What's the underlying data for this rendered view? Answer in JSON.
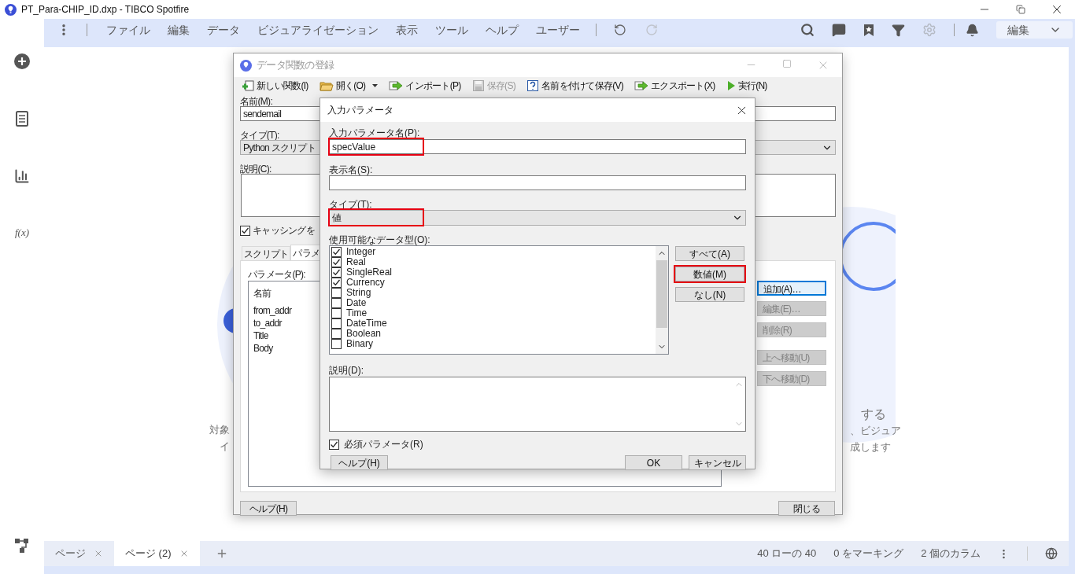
{
  "app": {
    "title": "PT_Para-CHIP_ID.dxp - TIBCO Spotfire"
  },
  "sidebar": {
    "function_label": "f(x)"
  },
  "menu": [
    "ファイル",
    "編集",
    "データ",
    "ビジュアライゼーション",
    "表示",
    "ツール",
    "ヘルプ",
    "ユーザー"
  ],
  "toolbar": {
    "redo_disabled": true,
    "settings_disabled": true,
    "mode": "編集"
  },
  "canvas_hint": {
    "left_lines": [
      "対象",
      "イ"
    ],
    "right_lines": [
      "する",
      "、ビジュア",
      "成します"
    ]
  },
  "function_dialog": {
    "title": "データ関数の登録",
    "toolbar": [
      {
        "kind": "new",
        "label": "新しい関数(I)",
        "disabled": false
      },
      {
        "kind": "open",
        "label": "開く(O)",
        "disabled": false
      },
      {
        "kind": "import",
        "label": "インポート(P)",
        "disabled": false
      },
      {
        "kind": "save",
        "label": "保存(S)",
        "disabled": true
      },
      {
        "kind": "save_as",
        "label": "名前を付けて保存(V)",
        "disabled": false
      },
      {
        "kind": "export",
        "label": "エクスポート(X)",
        "disabled": false
      },
      {
        "kind": "run",
        "label": "実行(N)",
        "disabled": false
      }
    ],
    "name_label": "名前(M):",
    "name_value": "sendemail",
    "type_label": "タイプ(T):",
    "type_value": "Python スクリプト",
    "desc_label": "説明(C):",
    "caching": {
      "label": "キャッシングを",
      "checked": true
    },
    "tabs": [
      {
        "label": "スクリプト",
        "selected": false
      },
      {
        "label": "パラメ",
        "selected": true
      }
    ],
    "params_label": "パラメータ(P):",
    "params_column": "名前",
    "params": [
      "from_addr",
      "to_addr",
      "Title",
      "Body"
    ],
    "side_buttons": [
      {
        "label": "追加(A)…",
        "disabled": false,
        "focused": true
      },
      {
        "label": "編集(E)…",
        "disabled": true,
        "focused": false
      },
      {
        "label": "削除(R)",
        "disabled": true,
        "focused": false
      },
      {
        "label": "上へ移動(U)",
        "disabled": true,
        "focused": false
      },
      {
        "label": "下へ移動(D)",
        "disabled": true,
        "focused": false
      }
    ],
    "help": "ヘルプ(H)",
    "close": "閉じる"
  },
  "param_dialog": {
    "title": "入力パラメータ",
    "name_label": "入力パラメータ名(P):",
    "name_value": "specValue",
    "name_highlighted": true,
    "display_label": "表示名(S):",
    "type_label": "タイプ(T):",
    "type_value": "値",
    "type_highlighted": true,
    "types_label": "使用可能なデータ型(O):",
    "data_types": [
      {
        "label": "Integer",
        "checked": true
      },
      {
        "label": "Real",
        "checked": true
      },
      {
        "label": "SingleReal",
        "checked": true
      },
      {
        "label": "Currency",
        "checked": true
      },
      {
        "label": "String",
        "checked": false
      },
      {
        "label": "Date",
        "checked": false
      },
      {
        "label": "Time",
        "checked": false
      },
      {
        "label": "DateTime",
        "checked": false
      },
      {
        "label": "Boolean",
        "checked": false
      },
      {
        "label": "Binary",
        "checked": false
      }
    ],
    "type_buttons": [
      {
        "label": "すべて(A)",
        "highlighted": false
      },
      {
        "label": "数値(M)",
        "highlighted": true
      },
      {
        "label": "なし(N)",
        "highlighted": false
      }
    ],
    "desc_label": "説明(D):",
    "required": {
      "label": "必須パラメータ(R)",
      "checked": true
    },
    "help": "ヘルプ(H)",
    "ok": "OK",
    "cancel": "キャンセル"
  },
  "page_tabs": [
    {
      "label": "ページ",
      "selected": false
    },
    {
      "label": "ページ (2)",
      "selected": true
    }
  ],
  "status": [
    "40 ローの 40",
    "0 をマーキング",
    "2 個のカラム"
  ]
}
